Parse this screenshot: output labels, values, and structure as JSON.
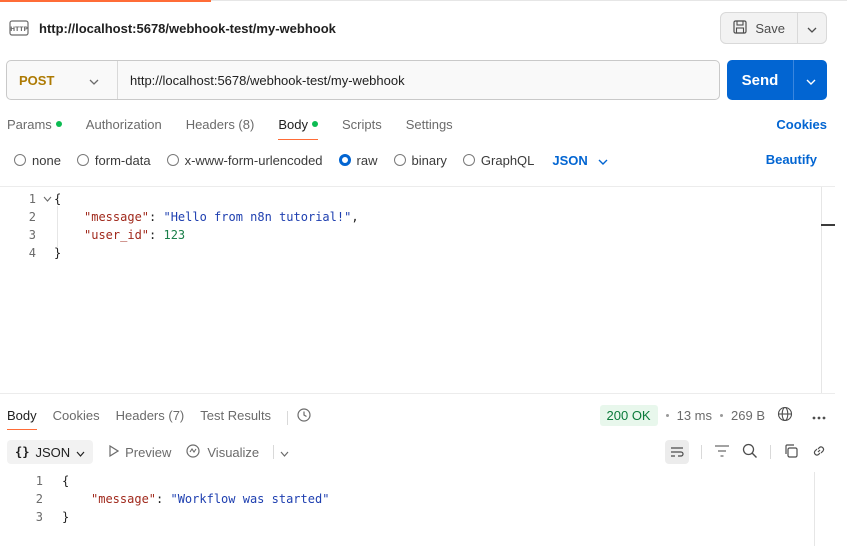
{
  "request": {
    "title": "http://localhost:5678/webhook-test/my-webhook",
    "save_label": "Save",
    "method": "POST",
    "url": "http://localhost:5678/webhook-test/my-webhook",
    "send_label": "Send"
  },
  "request_tabs": [
    {
      "label": "Params",
      "dot": true
    },
    {
      "label": "Authorization",
      "dot": false
    },
    {
      "label": "Headers (8)",
      "dot": false
    },
    {
      "label": "Body",
      "dot": true,
      "active": true
    },
    {
      "label": "Scripts",
      "dot": false
    },
    {
      "label": "Settings",
      "dot": false
    }
  ],
  "cookies_label": "Cookies",
  "body_types": [
    {
      "label": "none",
      "checked": false
    },
    {
      "label": "form-data",
      "checked": false
    },
    {
      "label": "x-www-form-urlencoded",
      "checked": false
    },
    {
      "label": "raw",
      "checked": true
    },
    {
      "label": "binary",
      "checked": false
    },
    {
      "label": "GraphQL",
      "checked": false
    }
  ],
  "body_format": "JSON",
  "beautify_label": "Beautify",
  "request_body": {
    "line_numbers": [
      "1",
      "2",
      "3",
      "4"
    ],
    "open_brace": "{",
    "close_brace": "}",
    "key1": "\"message\"",
    "val1": "\"Hello from n8n tutorial!\"",
    "key2": "\"user_id\"",
    "val2": "123"
  },
  "response_tabs": [
    {
      "label": "Body",
      "active": true
    },
    {
      "label": "Cookies"
    },
    {
      "label": "Headers (7)"
    },
    {
      "label": "Test Results"
    }
  ],
  "response_status": {
    "status": "200 OK",
    "time": "13 ms",
    "size": "269 B"
  },
  "response_toolbar": {
    "format": "JSON",
    "preview": "Preview",
    "visualize": "Visualize"
  },
  "response_body": {
    "line_numbers": [
      "1",
      "2",
      "3"
    ],
    "open_brace": "{",
    "close_brace": "}",
    "key1": "\"message\"",
    "val1": "\"Workflow was started\""
  },
  "colors": {
    "accent": "#ff6c37",
    "primary": "#0265d2",
    "method_post": "#ad7a03",
    "success": "#0cbb52"
  }
}
